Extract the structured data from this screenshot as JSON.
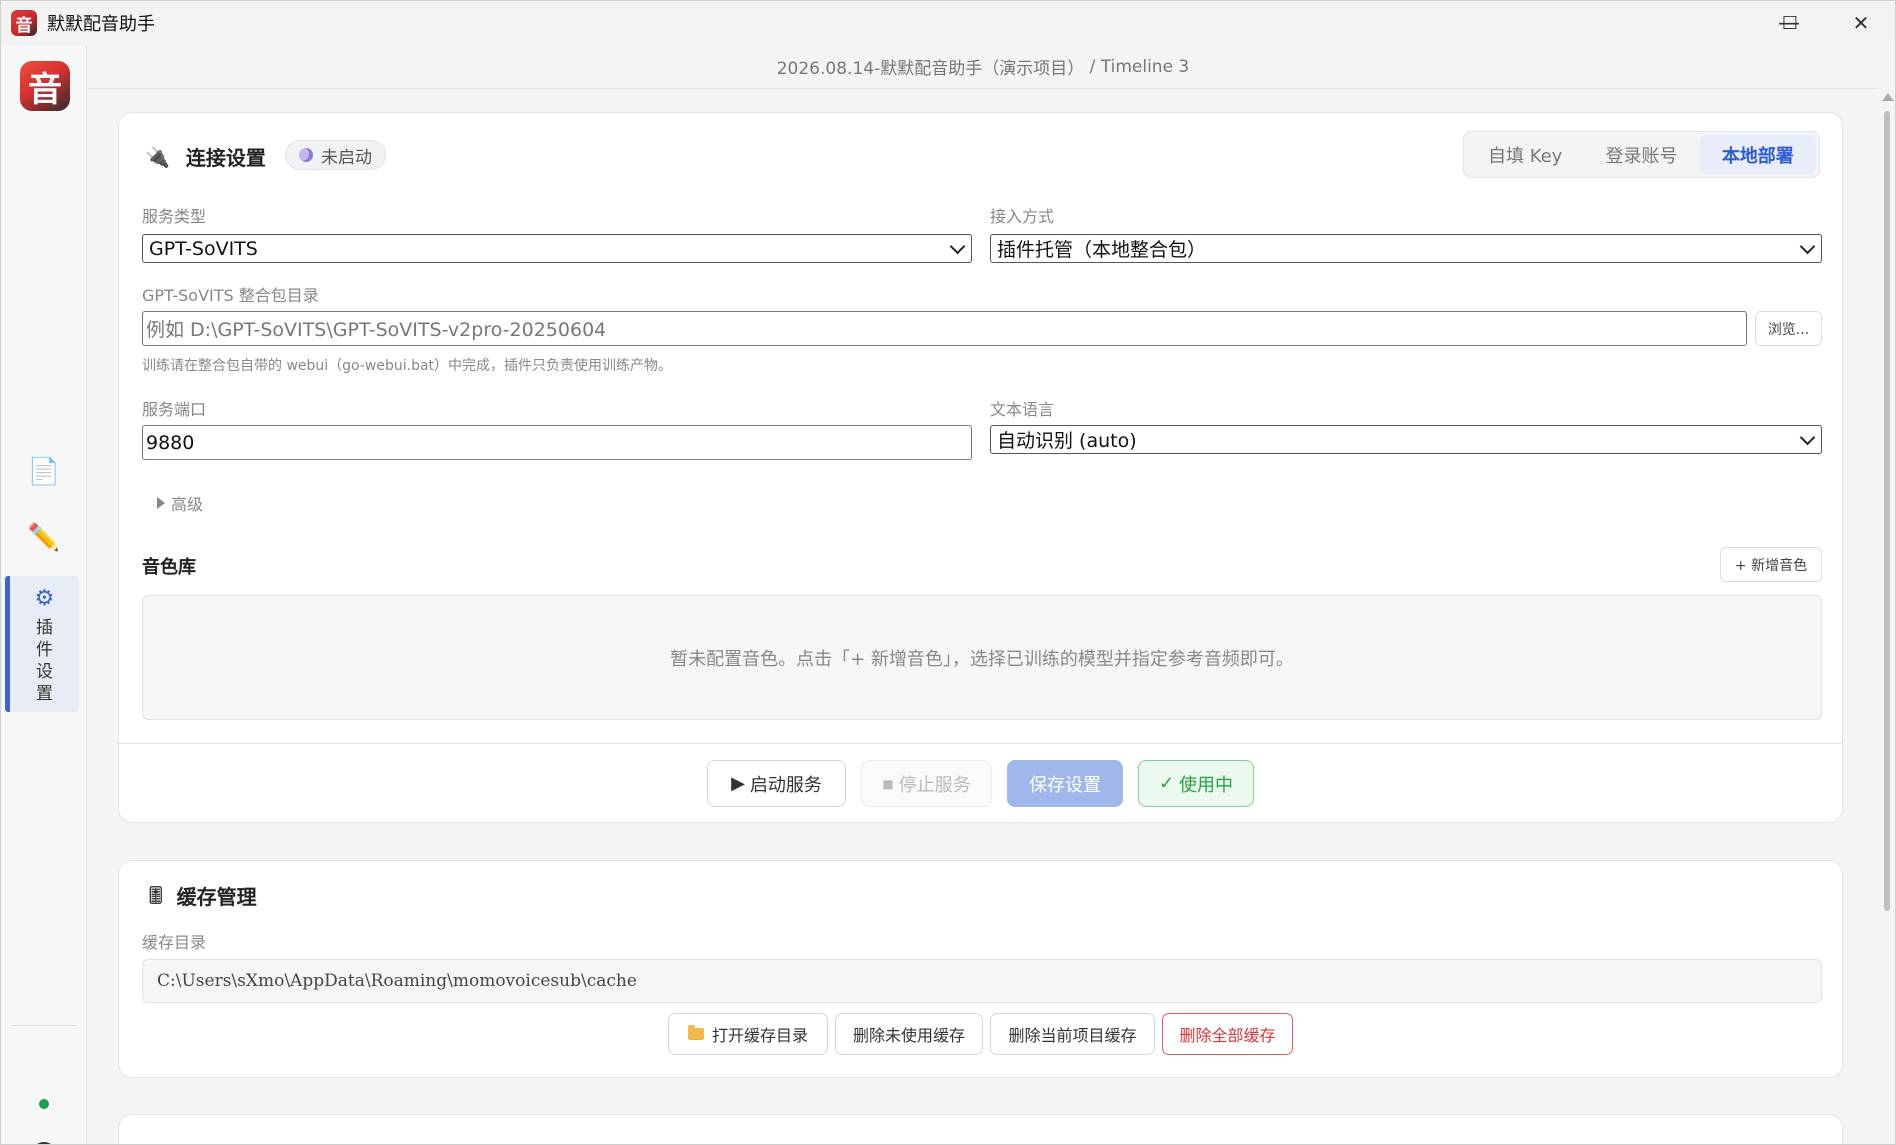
{
  "window": {
    "title": "默默配音助手",
    "app_icon_glyph": "音",
    "controls": {
      "minimize": "—",
      "maximize": "☐",
      "close": "✕"
    }
  },
  "breadcrumb": {
    "project": "2026.08.14-默默配音助手（演示项目）",
    "separator": " / ",
    "timeline": "Timeline 3"
  },
  "sidebar": {
    "logo_glyph": "音",
    "items": [
      {
        "icon": "document-icon",
        "glyph": "📄"
      },
      {
        "icon": "pencil-icon",
        "glyph": "✏️"
      },
      {
        "icon": "gear-icon",
        "glyph": "⚙",
        "label": "插件设置",
        "active": true
      }
    ],
    "status_color": "#1a9e48",
    "info_glyph": "i"
  },
  "connection": {
    "title": "连接设置",
    "plug_glyph": "🔌",
    "status_pill": "未启动",
    "modes": [
      {
        "label": "自填 Key",
        "active": false
      },
      {
        "label": "登录账号",
        "active": false
      },
      {
        "label": "本地部署",
        "active": true
      }
    ],
    "service_type": {
      "label": "服务类型",
      "value": "GPT-SoVITS"
    },
    "access_mode": {
      "label": "接入方式",
      "value": "插件托管（本地整合包）"
    },
    "package_dir": {
      "label": "GPT-SoVITS 整合包目录",
      "placeholder": "例如 D:\\GPT-SoVITS\\GPT-SoVITS-v2pro-20250604",
      "browse": "浏览...",
      "hint": "训练请在整合包自带的 webui（go-webui.bat）中完成，插件只负责使用训练产物。"
    },
    "port": {
      "label": "服务端口",
      "value": "9880"
    },
    "language": {
      "label": "文本语言",
      "value": "自动识别 (auto)"
    },
    "advanced": "高级",
    "voice_lib": {
      "title": "音色库",
      "add_button": "+ 新增音色",
      "empty_text": "暂未配置音色。点击「+ 新增音色」，选择已训练的模型并指定参考音频即可。"
    },
    "actions": {
      "start": "启动服务",
      "start_glyph": "▶",
      "stop": "停止服务",
      "stop_glyph": "■",
      "save": "保存设置",
      "in_use": "使用中",
      "in_use_glyph": "✓"
    }
  },
  "cache": {
    "title": "缓存管理",
    "icon_glyph": "🎚",
    "dir_label": "缓存目录",
    "dir_value": "C:\\Users\\sXmo\\AppData\\Roaming\\momovoicesub\\cache",
    "buttons": {
      "open": "打开缓存目录",
      "delete_unused": "删除未使用缓存",
      "delete_project": "删除当前项目缓存",
      "delete_all": "删除全部缓存"
    }
  },
  "colors": {
    "accent": "#3e63c9",
    "danger": "#d63838",
    "success": "#25a244",
    "save_bg": "#9fb7ea"
  }
}
